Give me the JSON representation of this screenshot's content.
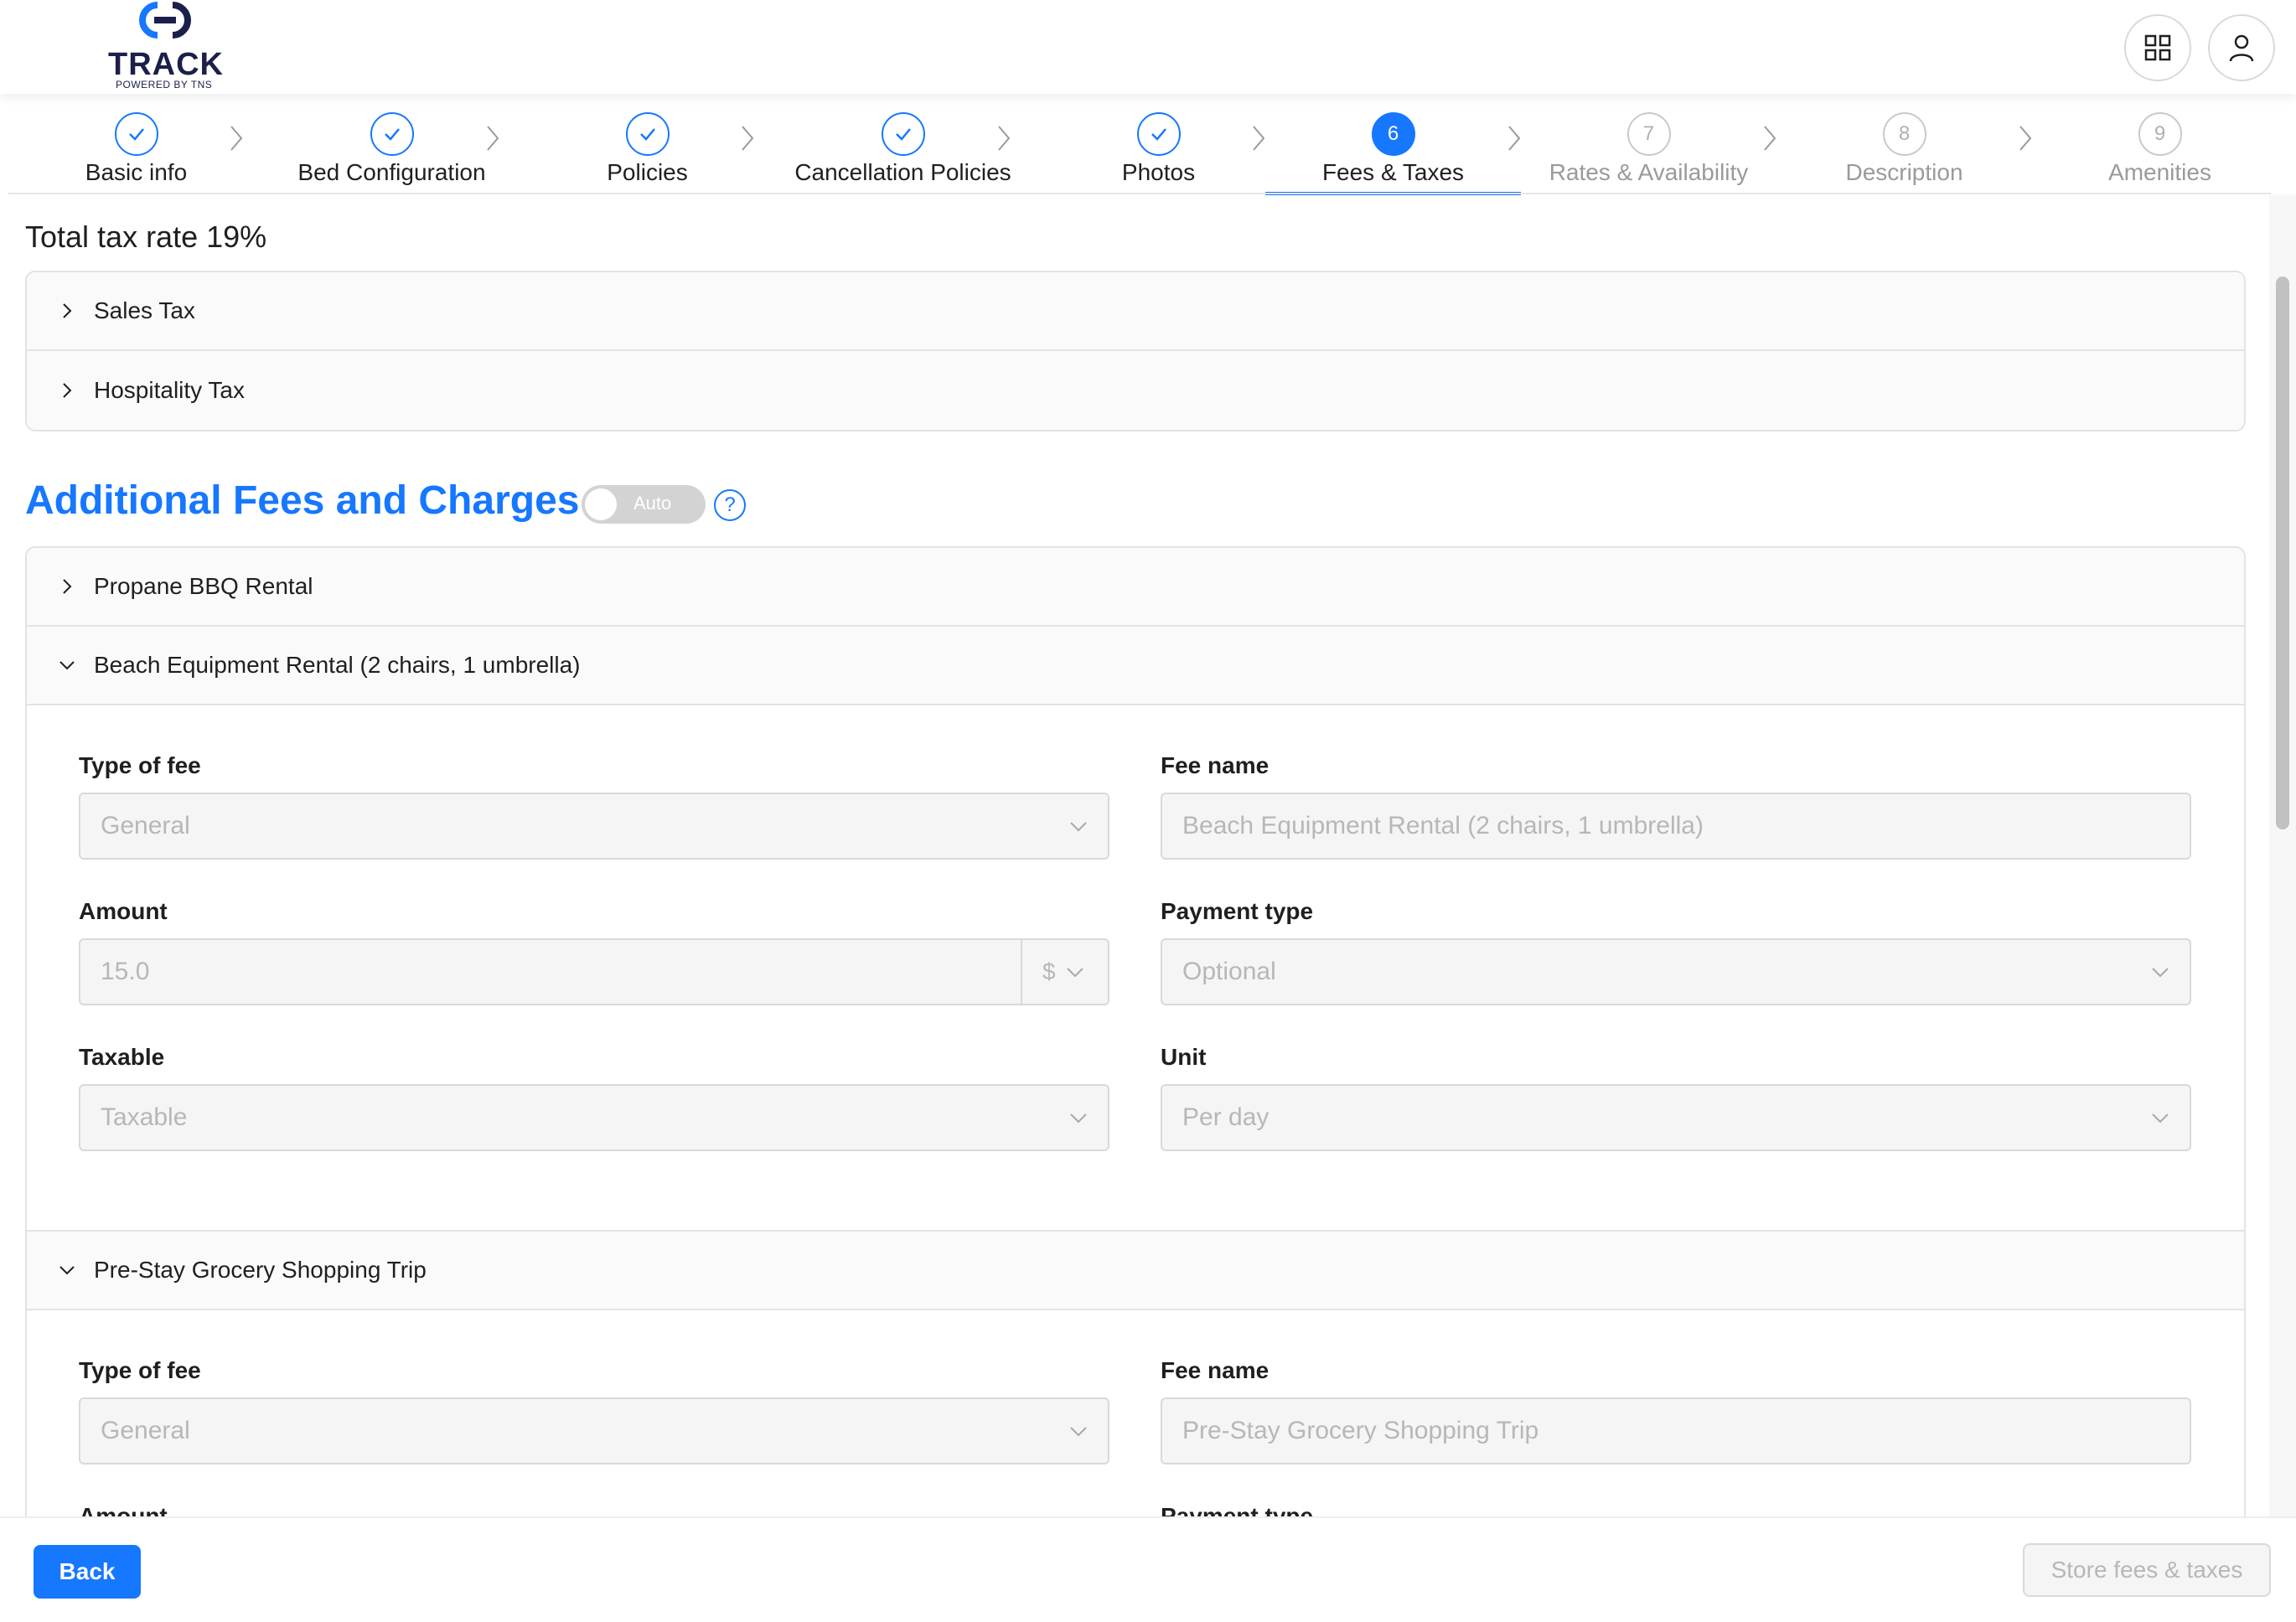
{
  "brand": {
    "name": "TRACK",
    "tagline": "POWERED BY TNS",
    "primary_color": "#1677ff",
    "logo_color": "#1b1f4b"
  },
  "header": {
    "apps_icon": "grid-icon",
    "user_icon": "user-icon"
  },
  "stepper": {
    "steps": [
      {
        "label": "Basic info",
        "status": "done"
      },
      {
        "label": "Bed Configuration",
        "status": "done"
      },
      {
        "label": "Policies",
        "status": "done"
      },
      {
        "label": "Cancellation Policies",
        "status": "done"
      },
      {
        "label": "Photos",
        "status": "done"
      },
      {
        "label": "Fees & Taxes",
        "number": "6",
        "status": "current"
      },
      {
        "label": "Rates & Availability",
        "number": "7",
        "status": "todo"
      },
      {
        "label": "Description",
        "number": "8",
        "status": "todo"
      },
      {
        "label": "Amenities",
        "number": "9",
        "status": "todo"
      }
    ]
  },
  "taxes": {
    "total_label": "Total tax rate 19%",
    "items": [
      "Sales Tax",
      "Hospitality Tax"
    ]
  },
  "fees": {
    "title": "Additional Fees and Charges",
    "auto_toggle_label": "Auto",
    "help_label": "?",
    "items": [
      {
        "title": "Propane BBQ Rental",
        "expanded": false
      },
      {
        "title": "Beach Equipment Rental (2 chairs, 1 umbrella)",
        "expanded": true,
        "labels": {
          "type": "Type of fee",
          "name": "Fee name",
          "amount": "Amount",
          "payment": "Payment type",
          "taxable": "Taxable",
          "unit": "Unit"
        },
        "values": {
          "type": "General",
          "name": "Beach Equipment Rental (2 chairs, 1 umbrella)",
          "amount": "15.0",
          "currency": "$",
          "payment": "Optional",
          "taxable": "Taxable",
          "unit": "Per day"
        }
      },
      {
        "title": "Pre-Stay Grocery Shopping Trip",
        "expanded": true,
        "labels": {
          "type": "Type of fee",
          "name": "Fee name",
          "amount": "Amount",
          "payment": "Payment type"
        },
        "values": {
          "type": "General",
          "name": "Pre-Stay Grocery Shopping Trip"
        }
      }
    ]
  },
  "footer": {
    "back_label": "Back",
    "store_label": "Store fees & taxes"
  }
}
